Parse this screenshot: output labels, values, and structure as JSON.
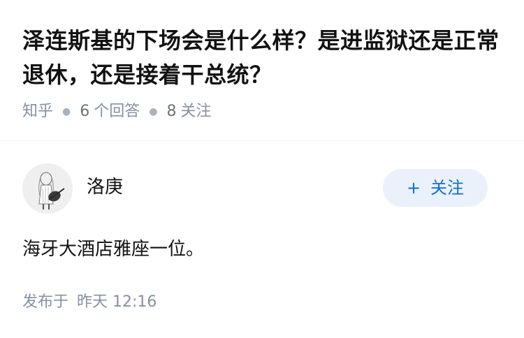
{
  "question": {
    "title": "泽连斯基的下场会是什么样？是进监狱还是正常退休，还是接着干总统？",
    "source": "知乎",
    "answer_count": "6",
    "answer_label": "个回答",
    "follower_count": "8",
    "follower_label": "关注"
  },
  "answer": {
    "author": {
      "name": "洛庚",
      "avatar_icon": "avatar-sketch-figure-with-guitar"
    },
    "follow_button": {
      "plus_icon": "+",
      "label": "关注"
    },
    "content": "海牙大酒店雅座一位。",
    "published_prefix": "发布于",
    "published_time": "昨天 12:16"
  },
  "colors": {
    "accent": "#0d6ed9",
    "button_bg": "#ebf1fa",
    "meta_gray": "#8590a6",
    "text": "#121212"
  }
}
